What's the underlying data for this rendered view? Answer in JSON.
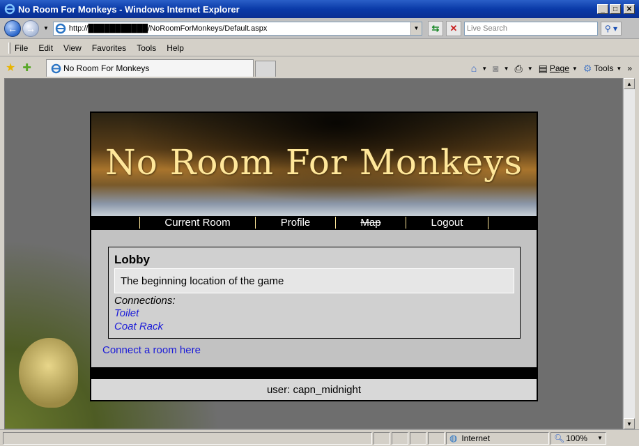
{
  "window": {
    "title": "No Room For Monkeys - Windows Internet Explorer",
    "minimize": "_",
    "maximize": "□",
    "close": "✕"
  },
  "addressbar": {
    "url": "http://███████████/NoRoomForMonkeys/Default.aspx",
    "search_placeholder": "Live Search"
  },
  "menu": {
    "items": [
      "File",
      "Edit",
      "View",
      "Favorites",
      "Tools",
      "Help"
    ]
  },
  "tabs": {
    "active_tab": "No Room For Monkeys"
  },
  "command_bar": {
    "page_label": "Page",
    "tools_label": "Tools",
    "more": "»"
  },
  "site": {
    "title": "No Room For Monkeys",
    "nav": [
      {
        "label": "Current Room",
        "struck": false
      },
      {
        "label": "Profile",
        "struck": false
      },
      {
        "label": "Map",
        "struck": true
      },
      {
        "label": "Logout",
        "struck": false
      }
    ],
    "room": {
      "name": "Lobby",
      "description": "The beginning location of the game",
      "connections_label": "Connections:",
      "connections": [
        "Toilet",
        "Coat Rack"
      ]
    },
    "connect_link": "Connect a room here",
    "footer_user": "user: capn_midnight"
  },
  "statusbar": {
    "zone": "Internet",
    "zoom": "100%"
  }
}
